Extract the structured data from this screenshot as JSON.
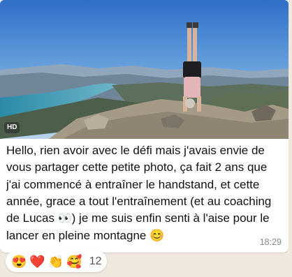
{
  "media": {
    "hd_badge": "HD"
  },
  "message": {
    "line1": "Hello, rien avoir avec le défi mais j'avais envie de",
    "line2": "vous partager cette petite photo, ça fait 2 ans que",
    "line3": "j'ai commencé à entraîner le handstand, et cette",
    "line4_a": "année, grace a tout l'entraînement (et au coaching",
    "line5_a": "de Lucas ",
    "eyes": "👀",
    "line5_b": ") je me suis enfin senti à l'aise pour le",
    "line6_a": "lancer en pleine montagne ",
    "smile": "😊",
    "time": "18:29"
  },
  "reactions": {
    "emojis": [
      "😍",
      "❤️",
      "👏",
      "🥰"
    ],
    "count": "12"
  }
}
